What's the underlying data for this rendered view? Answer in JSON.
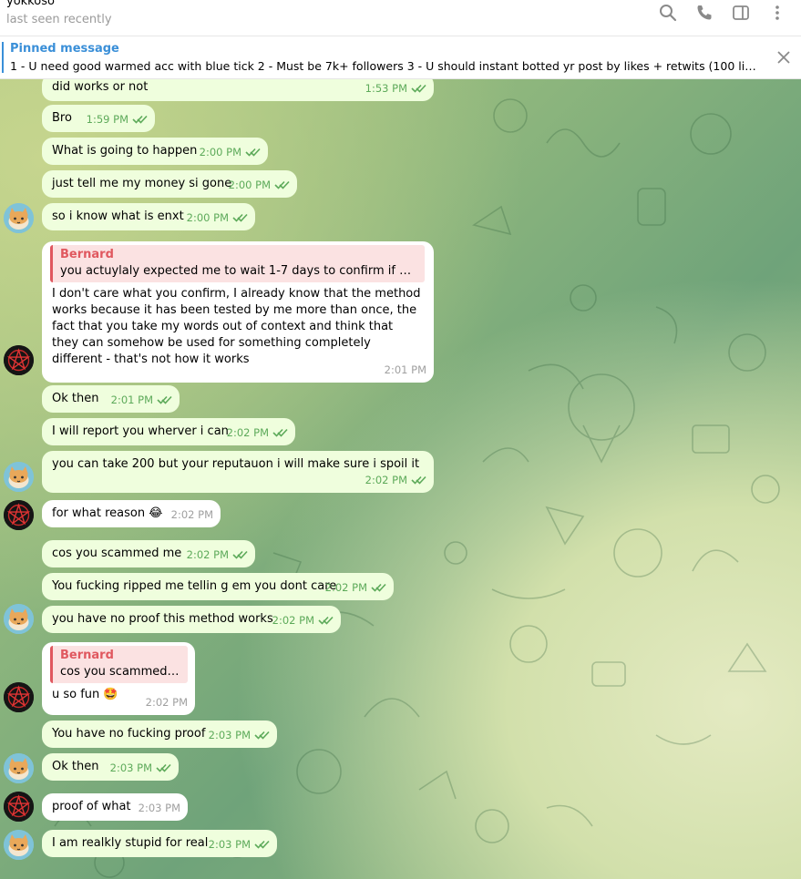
{
  "header": {
    "title": "yokkoso",
    "status": "last seen recently",
    "icons": [
      "search-icon",
      "phone-icon",
      "sidebar-icon",
      "more-icon"
    ]
  },
  "pinned": {
    "title": "Pinned message",
    "text": "1 - U need good warmed acc with blue tick  2 - Must be 7k+ followers 3 - U should instant botted yr post by likes + retwits (100 likes + 100 ..."
  },
  "messages": [
    {
      "text": "did works or not",
      "time": "1:53 PM"
    },
    {
      "text": "Bro",
      "time": "1:59 PM"
    },
    {
      "text": "What is going to happen",
      "time": "2:00 PM"
    },
    {
      "text": "just tell me my money si gone",
      "time": "2:00 PM"
    },
    {
      "text": "so i know what is enxt",
      "time": "2:00 PM"
    },
    {
      "reply_name": "Bernard",
      "reply_text": "you actuylaly expected me to wait 1-7 days to confirm if what yo...",
      "text": "I don't care what you confirm, I already know that the method works because it has been tested by me more than once, the fact that you take my words out of context and think that they can somehow be used for something completely different - that's not how it works",
      "time": "2:01 PM"
    },
    {
      "text": "Ok then",
      "time": "2:01 PM"
    },
    {
      "text": "I will report you wherver i can",
      "time": "2:02 PM"
    },
    {
      "text": "you can take 200 but your reputauon i will make sure i spoil it",
      "time": "2:02 PM"
    },
    {
      "text": "for what reason 😂",
      "time": "2:02 PM"
    },
    {
      "text": "cos you scammed me",
      "time": "2:02 PM"
    },
    {
      "text": "You fucking ripped me tellin g em you dont care",
      "time": "2:02 PM"
    },
    {
      "text": "you have no proof this method works",
      "time": "2:02 PM"
    },
    {
      "reply_name": "Bernard",
      "reply_text": "cos you scammed me",
      "text": "u so fun 🤩",
      "time": "2:02 PM"
    },
    {
      "text": "You have no fucking proof",
      "time": "2:03 PM"
    },
    {
      "text": "Ok then",
      "time": "2:03 PM"
    },
    {
      "text": "proof of what",
      "time": "2:03 PM"
    },
    {
      "text": "I am realkly stupid for real",
      "time": "2:03 PM"
    }
  ],
  "colors": {
    "outgoing": "#effedd",
    "incoming": "#ffffff",
    "accent": "#3a8fd8",
    "reply": "#e0585f",
    "ticks": "#5daa5a"
  }
}
